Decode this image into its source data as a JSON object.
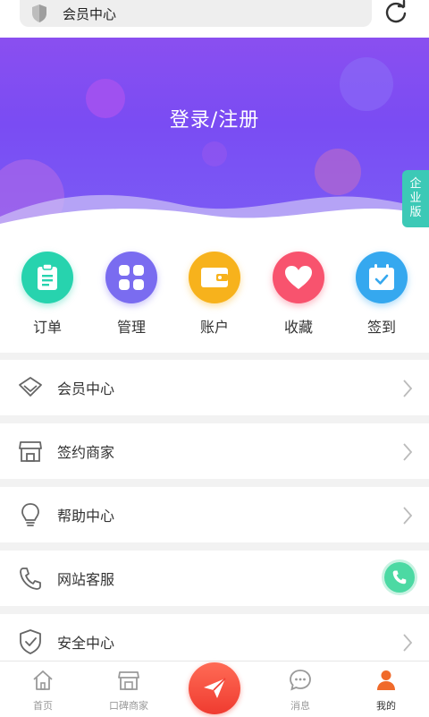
{
  "address_bar": {
    "text": "会员中心"
  },
  "hero": {
    "login_text": "登录/注册",
    "enterprise_tab": [
      "企",
      "业",
      "版"
    ]
  },
  "quick_actions": [
    {
      "label": "订单",
      "icon": "clipboard-icon",
      "color": "#27d3ae"
    },
    {
      "label": "管理",
      "icon": "grid-icon",
      "color": "#7a6cf0"
    },
    {
      "label": "账户",
      "icon": "wallet-icon",
      "color": "#f7b21c"
    },
    {
      "label": "收藏",
      "icon": "heart-icon",
      "color": "#f8536e"
    },
    {
      "label": "签到",
      "icon": "calendar-check-icon",
      "color": "#35a8ef"
    }
  ],
  "menu": [
    {
      "label": "会员中心",
      "icon": "diamond-icon"
    },
    {
      "label": "签约商家",
      "icon": "store-icon"
    },
    {
      "label": "帮助中心",
      "icon": "lightbulb-icon"
    },
    {
      "label": "网站客服",
      "icon": "phone-icon"
    },
    {
      "label": "安全中心",
      "icon": "shield-check-icon"
    }
  ],
  "bottom_nav": [
    {
      "label": "首页",
      "icon": "home-icon",
      "active": false
    },
    {
      "label": "口碑商家",
      "icon": "store-icon",
      "active": false
    },
    {
      "label": "",
      "icon": "send-icon",
      "active": false
    },
    {
      "label": "消息",
      "icon": "message-icon",
      "active": false
    },
    {
      "label": "我的",
      "icon": "user-icon",
      "active": true
    }
  ],
  "colors": {
    "hero": "#7a4cf3",
    "accent_orange": "#f06a2a",
    "call_green": "#4cd9a3",
    "enterprise_teal": "#3cc9b6"
  }
}
